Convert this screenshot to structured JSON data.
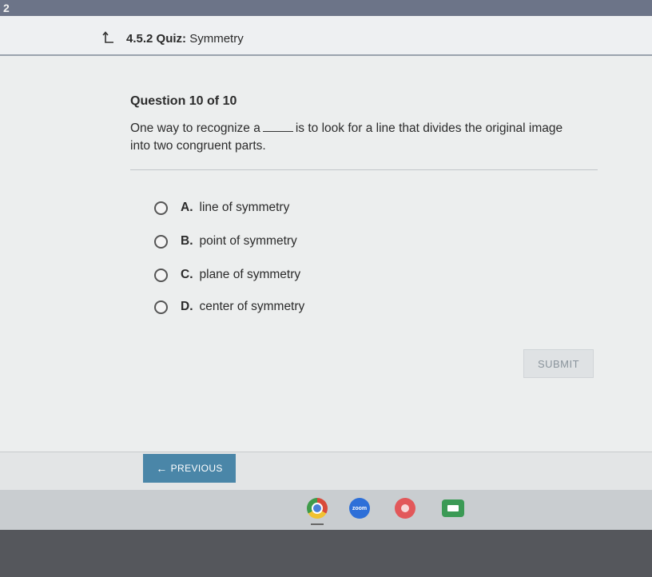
{
  "topbar": {
    "number": "2"
  },
  "header": {
    "quiz_code": "4.5.2",
    "quiz_label": "Quiz:",
    "quiz_name": "Symmetry"
  },
  "question": {
    "number_text": "Question 10 of 10",
    "text_before": "One way to recognize a",
    "text_after": "is to look for a line that divides the original image into two congruent parts."
  },
  "options": [
    {
      "letter": "A.",
      "label": "line of symmetry"
    },
    {
      "letter": "B.",
      "label": "point of symmetry"
    },
    {
      "letter": "C.",
      "label": "plane of symmetry"
    },
    {
      "letter": "D.",
      "label": "center of symmetry"
    }
  ],
  "submit_label": "SUBMIT",
  "footer": {
    "previous_label": "PREVIOUS"
  },
  "taskbar": {
    "zoom_label": "zoom"
  },
  "colors": {
    "accent": "#4a86a8",
    "submit_disabled": "#dfe2e4"
  }
}
